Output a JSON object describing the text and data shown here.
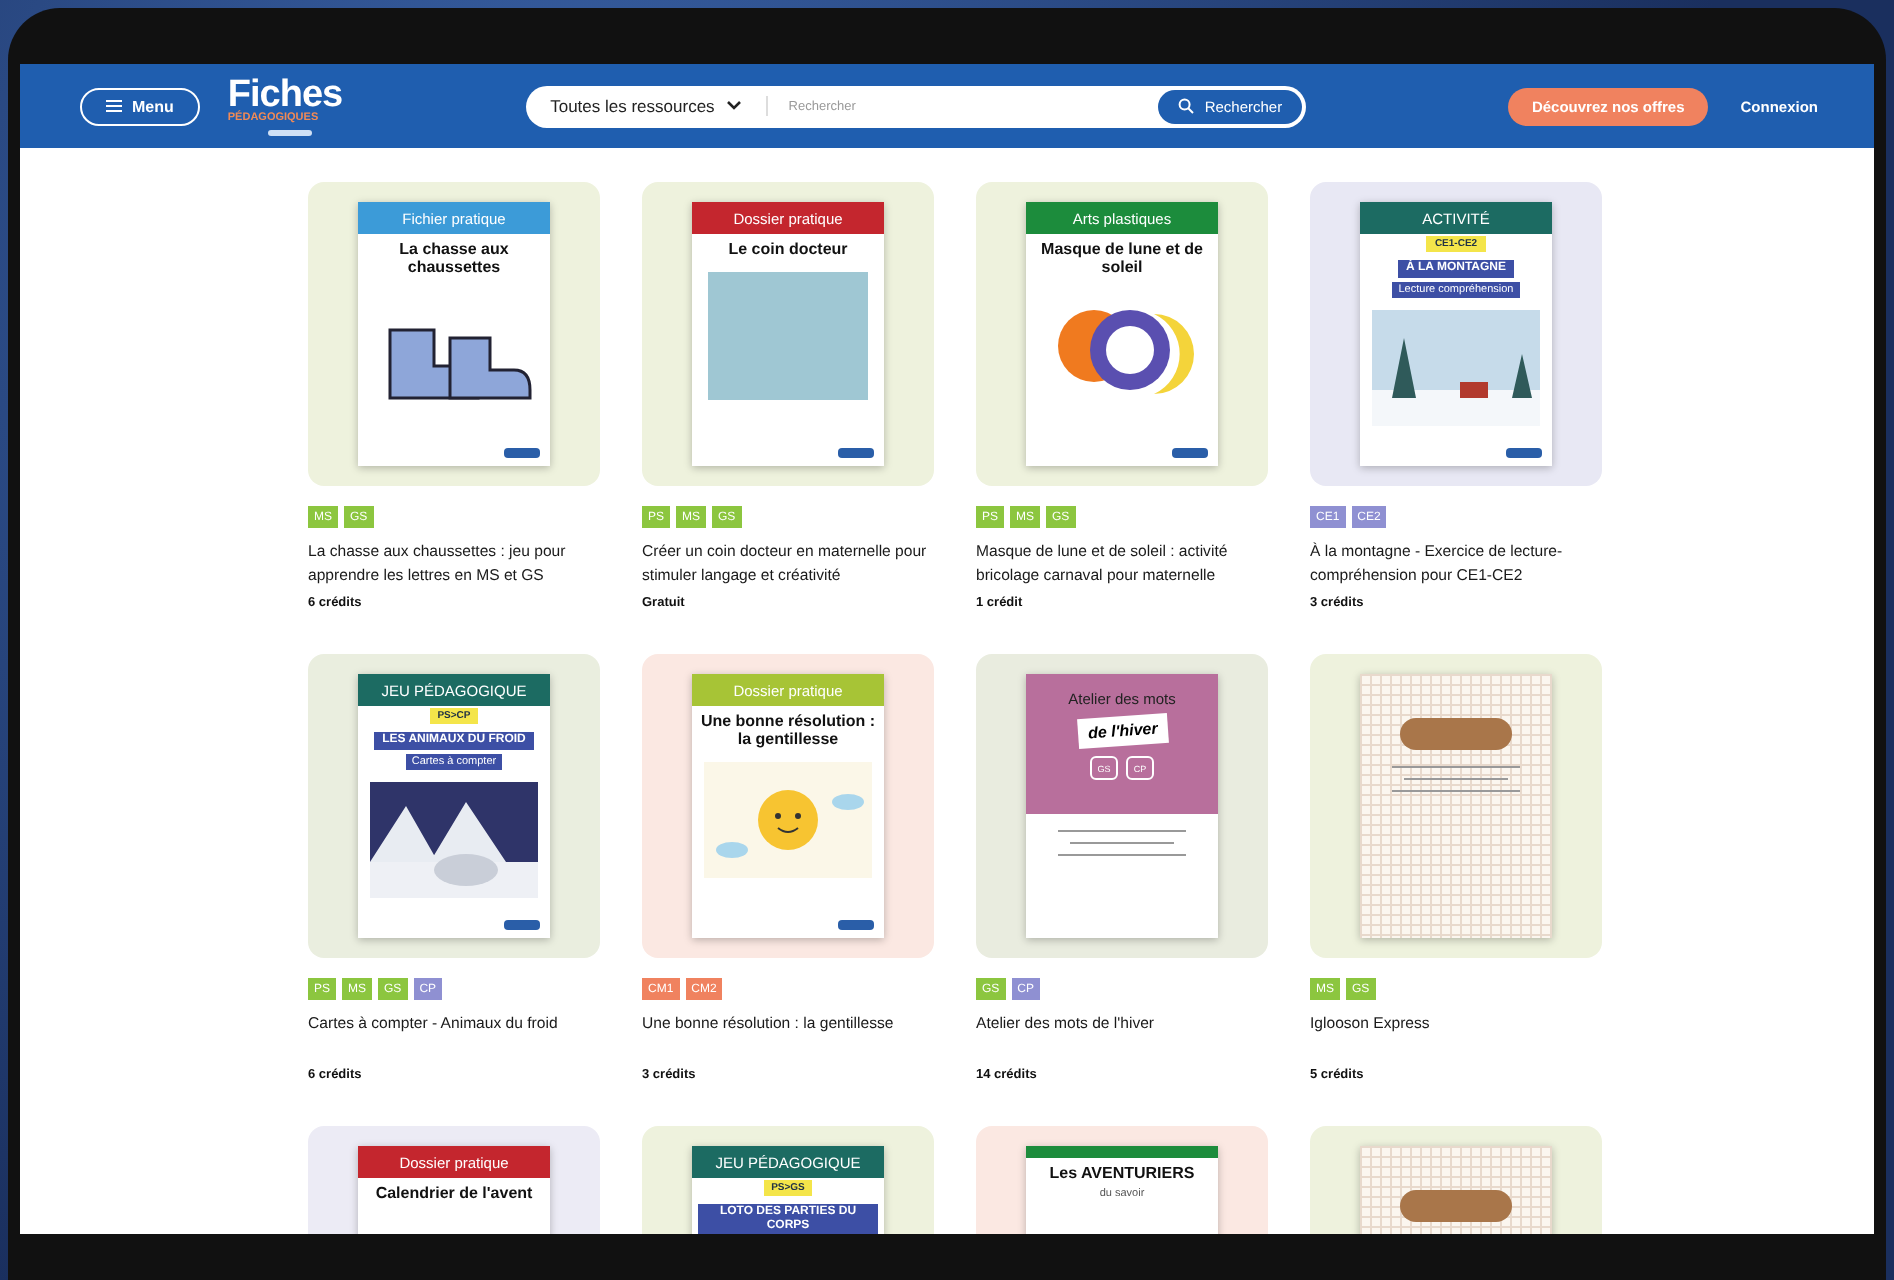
{
  "nav": {
    "menu": "Menu",
    "logo_title": "Fiches",
    "logo_subtitle": "PÉDAGOGIQUES",
    "category": "Toutes les ressources",
    "search_placeholder": "Rechercher",
    "search_button": "Rechercher",
    "offer_button": "Découvrez nos offres",
    "login": "Connexion"
  },
  "cards": [
    {
      "color": "#eef2dd",
      "cover": {
        "kind": "band",
        "color": "#3c9bd8",
        "header": "Fichier pratique",
        "title": "La chasse aux chaussettes",
        "art": {
          "kind": "socks"
        }
      },
      "tags": [
        {
          "label": "MS",
          "color": "#8cc63f"
        },
        {
          "label": "GS",
          "color": "#8cc63f"
        }
      ],
      "title": "La chasse aux chaussettes : jeu pour apprendre les lettres en MS et GS",
      "credits": "6 crédits"
    },
    {
      "color": "#eef2dd",
      "cover": {
        "kind": "band",
        "color": "#c4262e",
        "header": "Dossier pratique",
        "title": "Le coin docteur",
        "art": {
          "kind": "photo"
        }
      },
      "tags": [
        {
          "label": "PS",
          "color": "#8cc63f"
        },
        {
          "label": "MS",
          "color": "#8cc63f"
        },
        {
          "label": "GS",
          "color": "#8cc63f"
        }
      ],
      "title": "Créer un coin docteur en maternelle pour stimuler langage et créativité",
      "credits": "Gratuit"
    },
    {
      "color": "#eef2dd",
      "cover": {
        "kind": "band",
        "color": "#1c8c3c",
        "header": "Arts plastiques",
        "title": "Masque de lune et de soleil",
        "art": {
          "kind": "moon"
        }
      },
      "tags": [
        {
          "label": "PS",
          "color": "#8cc63f"
        },
        {
          "label": "MS",
          "color": "#8cc63f"
        },
        {
          "label": "GS",
          "color": "#8cc63f"
        }
      ],
      "title": "Masque de lune et de soleil : activité bricolage carnaval pour maternelle",
      "credits": "1 crédit"
    },
    {
      "color": "#e8e8f4",
      "cover": {
        "kind": "band",
        "color": "#1c6b62",
        "header": "ACTIVITÉ",
        "badge": "CE1-CE2",
        "title": "À LA MONTAGNE",
        "subtitle": "Lecture compréhension",
        "art": {
          "kind": "winter"
        }
      },
      "tags": [
        {
          "label": "CE1",
          "color": "#8f90d2"
        },
        {
          "label": "CE2",
          "color": "#8f90d2"
        }
      ],
      "title": "À la montagne - Exercice de lecture-compréhension pour CE1-CE2",
      "credits": "3 crédits"
    },
    {
      "color": "#eaeedf",
      "cover": {
        "kind": "band",
        "color": "#1c6b62",
        "header": "JEU PÉDAGOGIQUE",
        "badge": "PS>CP",
        "title": "LES ANIMAUX DU FROID",
        "subtitle": "Cartes à compter",
        "art": {
          "kind": "bear"
        }
      },
      "tags": [
        {
          "label": "PS",
          "color": "#8cc63f"
        },
        {
          "label": "MS",
          "color": "#8cc63f"
        },
        {
          "label": "GS",
          "color": "#8cc63f"
        },
        {
          "label": "CP",
          "color": "#8f90d2"
        }
      ],
      "title": "Cartes à compter - Animaux du froid",
      "credits": "6 crédits"
    },
    {
      "color": "#fbe8e2",
      "cover": {
        "kind": "band",
        "color": "#a7c436",
        "header": "Dossier pratique",
        "title": "Une bonne résolution : la gentillesse",
        "art": {
          "kind": "sun"
        }
      },
      "tags": [
        {
          "label": "CM1",
          "color": "#f0825f"
        },
        {
          "label": "CM2",
          "color": "#f0825f"
        }
      ],
      "title": "Une bonne résolution : la gentillesse",
      "credits": "3 crédits"
    },
    {
      "color": "#e9ecdf",
      "cover": {
        "kind": "panel",
        "color": "#b86f9c",
        "header": "Atelier des mots",
        "title": "de l'hiver",
        "badges": [
          "GS",
          "CP"
        ],
        "art": {
          "kind": "lines"
        }
      },
      "tags": [
        {
          "label": "GS",
          "color": "#8cc63f"
        },
        {
          "label": "CP",
          "color": "#8f90d2"
        }
      ],
      "title": "Atelier des mots de l'hiver",
      "credits": "14 crédits"
    },
    {
      "color": "#eef2dd",
      "cover": {
        "kind": "grid",
        "color": "#a9764a",
        "art": {
          "kind": "lines"
        }
      },
      "tags": [
        {
          "label": "MS",
          "color": "#8cc63f"
        },
        {
          "label": "GS",
          "color": "#8cc63f"
        }
      ],
      "title": "Iglooson Express",
      "credits": "5 crédits"
    },
    {
      "color": "#ecebf5",
      "cover": {
        "kind": "band",
        "color": "#c4262e",
        "header": "Dossier pratique",
        "title": "Calendrier de l'avent"
      }
    },
    {
      "color": "#eef2dd",
      "cover": {
        "kind": "band",
        "color": "#1c6b62",
        "header": "JEU PÉDAGOGIQUE",
        "badge": "PS>GS",
        "title": "LOTO DES PARTIES DU CORPS"
      }
    },
    {
      "color": "#fbe8e2",
      "cover": {
        "kind": "band",
        "color": "#1c8c3c",
        "title": "Les AVENTURIERS",
        "subtitle": "du savoir"
      }
    },
    {
      "color": "#eef2dd",
      "cover": {
        "kind": "grid",
        "color": "#a9764a"
      }
    }
  ]
}
